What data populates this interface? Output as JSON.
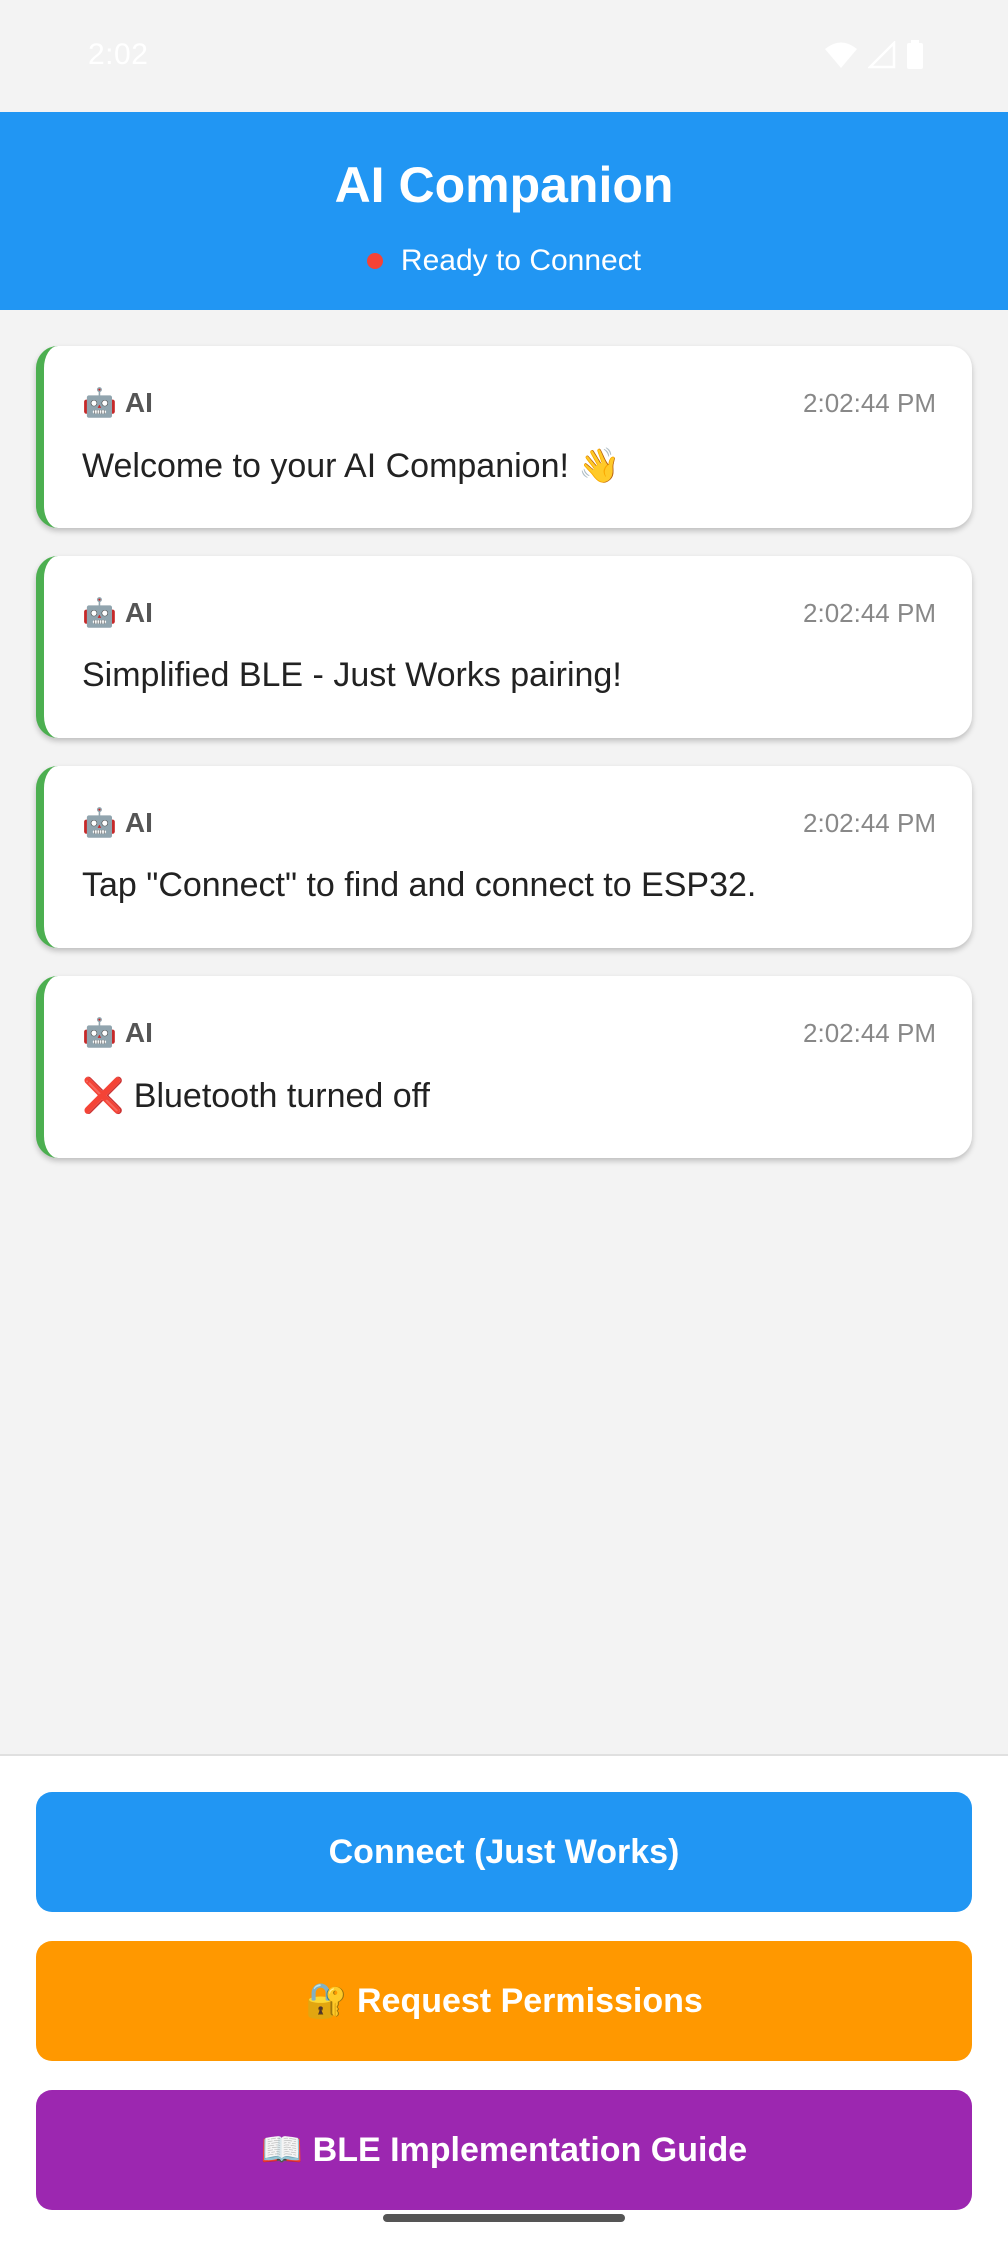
{
  "status_bar": {
    "time": "2:02",
    "icons": [
      "wifi-icon",
      "signal-icon",
      "battery-icon"
    ]
  },
  "header": {
    "title": "AI Companion",
    "status_text": "Ready to Connect",
    "status_color": "#f44336",
    "background": "#2196f3"
  },
  "messages": [
    {
      "sender_emoji": "🤖",
      "sender": "AI",
      "time": "2:02:44 PM",
      "text": "Welcome to your AI Companion! 👋"
    },
    {
      "sender_emoji": "🤖",
      "sender": "AI",
      "time": "2:02:44 PM",
      "text": "Simplified BLE - Just Works pairing!"
    },
    {
      "sender_emoji": "🤖",
      "sender": "AI",
      "time": "2:02:44 PM",
      "text": "Tap \"Connect\" to find and connect to ESP32."
    },
    {
      "sender_emoji": "🤖",
      "sender": "AI",
      "time": "2:02:44 PM",
      "text": "❌ Bluetooth turned off"
    }
  ],
  "buttons": {
    "connect": {
      "label": "Connect (Just Works)",
      "color": "#2196f3"
    },
    "permissions": {
      "label": "🔐 Request Permissions",
      "color": "#ff9800"
    },
    "guide": {
      "label": "📖 BLE Implementation Guide",
      "color": "#9c27b0"
    }
  }
}
